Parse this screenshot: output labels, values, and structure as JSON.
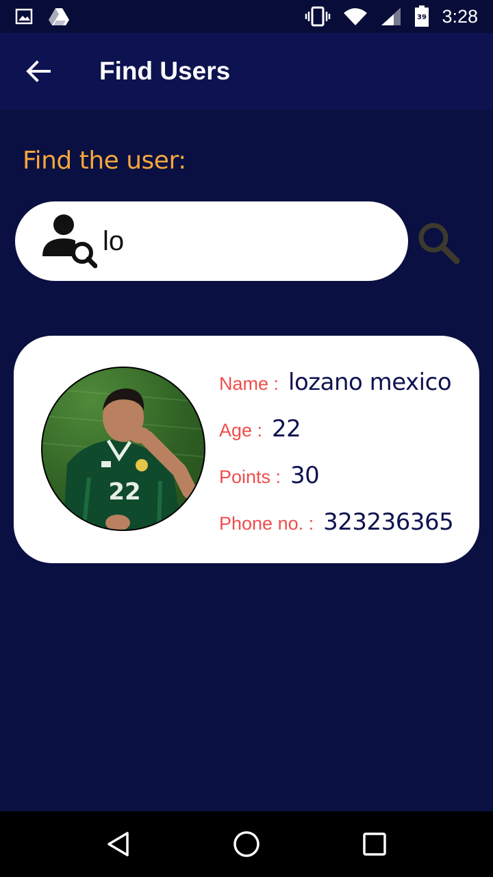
{
  "status_bar": {
    "time": "3:28",
    "battery_level": "39",
    "icons": [
      "image-icon",
      "drive-icon",
      "vibrate-icon",
      "wifi-icon",
      "signal-icon",
      "battery-icon"
    ]
  },
  "app_bar": {
    "title": "Find Users",
    "back_icon": "arrow-back-icon"
  },
  "search": {
    "heading": "Find the user:",
    "value": "lo",
    "search_icon": "search-icon",
    "user_icon": "user-search-icon"
  },
  "result": {
    "name_label": "Name :",
    "name": "lozano mexico",
    "age_label": "Age :",
    "age": "22",
    "points_label": "Points :",
    "points": "30",
    "phone_label": "Phone no. :",
    "phone": "323236365",
    "avatar_jersey_number": "22"
  },
  "colors": {
    "background": "#0b1042",
    "app_bar": "#0d1250",
    "heading": "#f5a73b",
    "label": "#f04c4c",
    "value": "#0d1250",
    "card": "#ffffff"
  },
  "nav": {
    "icons": [
      "back-triangle-icon",
      "home-circle-icon",
      "recents-square-icon"
    ]
  }
}
